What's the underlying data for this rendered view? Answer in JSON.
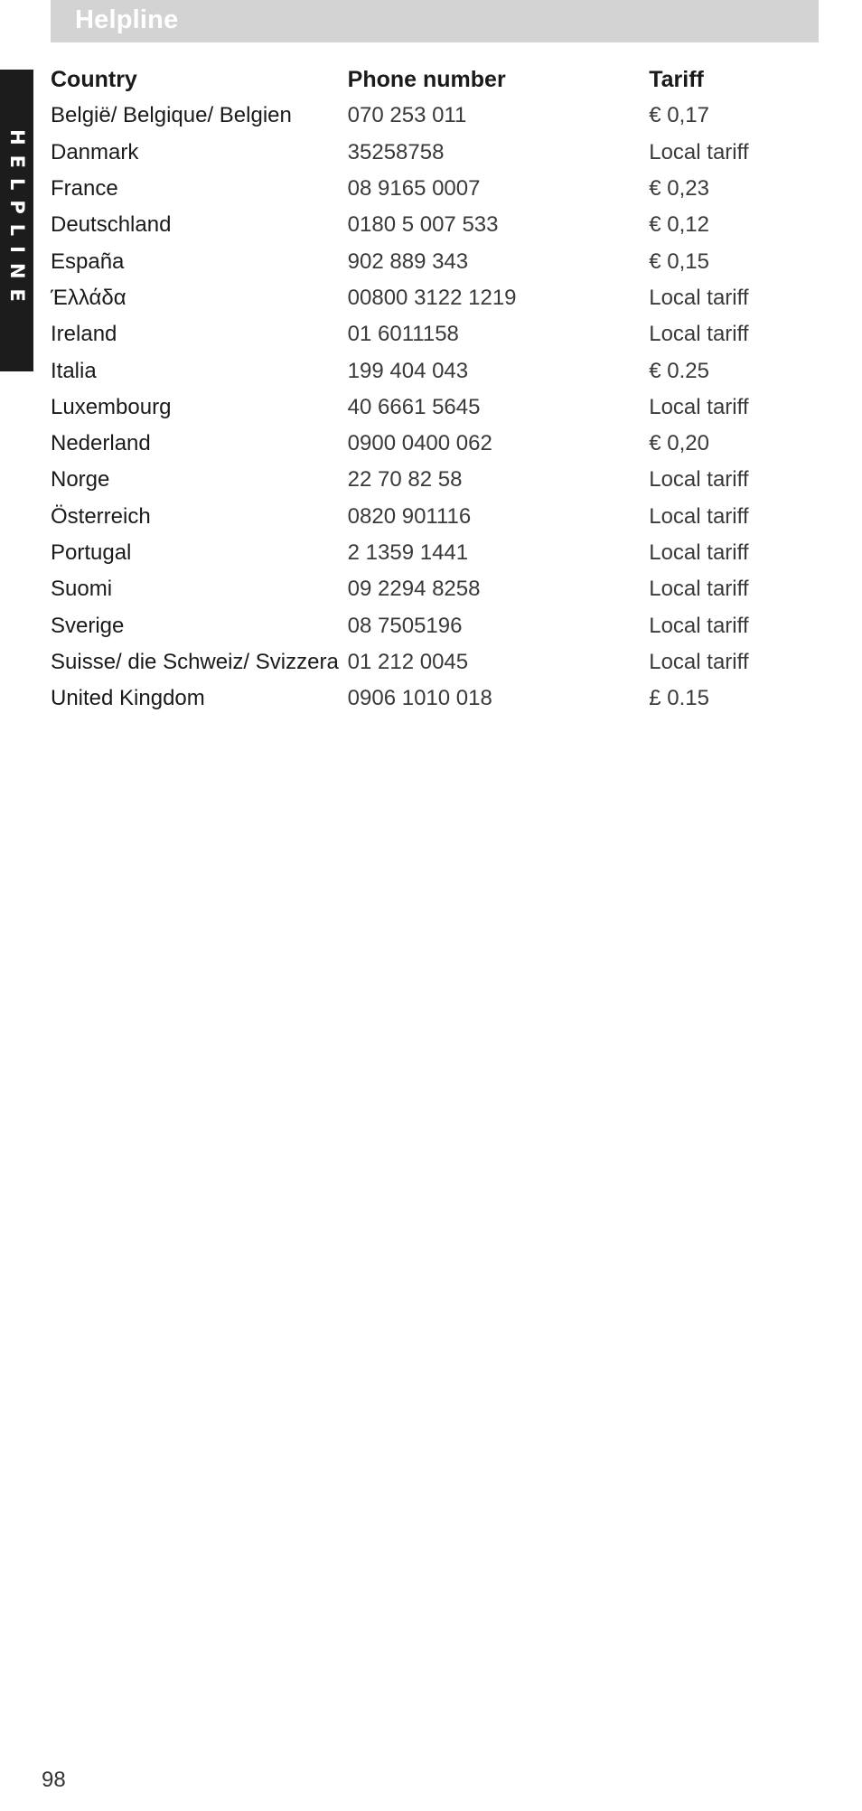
{
  "header": {
    "title": "Helpline"
  },
  "side_tab": {
    "label": "HELPLINE"
  },
  "table": {
    "columns": [
      "Country",
      "Phone number",
      "Tariff"
    ],
    "rows": [
      {
        "country": "België/ Belgique/ Belgien",
        "phone": "070 253 011",
        "tariff": "€ 0,17"
      },
      {
        "country": "Danmark",
        "phone": "35258758",
        "tariff": "Local tariff"
      },
      {
        "country": "France",
        "phone": "08 9165 0007",
        "tariff": "€ 0,23"
      },
      {
        "country": "Deutschland",
        "phone": "0180 5 007 533",
        "tariff": "€ 0,12"
      },
      {
        "country": "España",
        "phone": "902 889 343",
        "tariff": "€ 0,15"
      },
      {
        "country": "Έλλάδα",
        "phone": "00800 3122 1219",
        "tariff": "Local tariff"
      },
      {
        "country": "Ireland",
        "phone": "01 6011158",
        "tariff": "Local tariff"
      },
      {
        "country": "Italia",
        "phone": "199 404 043",
        "tariff": "€ 0.25"
      },
      {
        "country": "Luxembourg",
        "phone": "40 6661 5645",
        "tariff": "Local tariff"
      },
      {
        "country": "Nederland",
        "phone": "0900 0400 062",
        "tariff": "€ 0,20"
      },
      {
        "country": "Norge",
        "phone": "22 70 82 58",
        "tariff": "Local tariff"
      },
      {
        "country": "Österreich",
        "phone": "0820 901116",
        "tariff": "Local tariff"
      },
      {
        "country": "Portugal",
        "phone": "2 1359 1441",
        "tariff": "Local tariff"
      },
      {
        "country": "Suomi",
        "phone": "09 2294 8258",
        "tariff": "Local tariff"
      },
      {
        "country": "Sverige",
        "phone": "08 7505196",
        "tariff": "Local tariff"
      },
      {
        "country": "Suisse/ die Schweiz/ Svizzera",
        "phone": "01 212 0045",
        "tariff": "Local tariff"
      },
      {
        "country": "United Kingdom",
        "phone": "0906 1010 018",
        "tariff": "£ 0.15"
      }
    ]
  },
  "footer": {
    "page_number": "98"
  }
}
